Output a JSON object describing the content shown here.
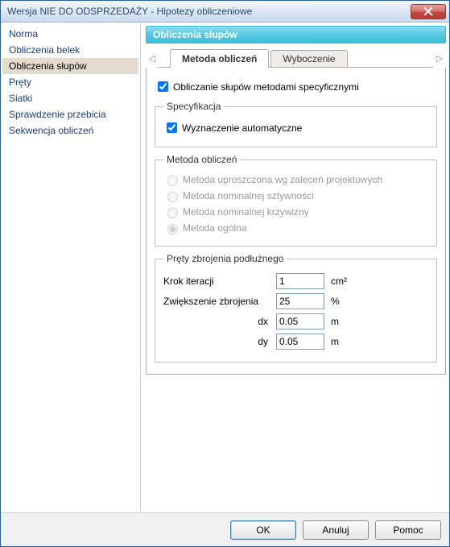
{
  "titlebar": {
    "text": "Wersja NIE DO ODSPRZEDAŻY - Hipotezy obliczeniowe"
  },
  "sidebar": {
    "items": [
      {
        "label": "Norma",
        "selected": false
      },
      {
        "label": "Obliczenia belek",
        "selected": false
      },
      {
        "label": "Obliczenia słupów",
        "selected": true
      },
      {
        "label": "Pręty",
        "selected": false
      },
      {
        "label": "Siatki",
        "selected": false
      },
      {
        "label": "Sprawdzenie przebicia",
        "selected": false
      },
      {
        "label": "Sekwencja obliczeń",
        "selected": false
      }
    ]
  },
  "content": {
    "section_title": "Obliczenia słupów",
    "tabs": [
      {
        "label": "Metoda obliczeń",
        "active": true
      },
      {
        "label": "Wyboczenie",
        "active": false
      }
    ],
    "main_check": {
      "label": "Obliczanie słupów metodami specyficznymi",
      "checked": true
    },
    "spec_group": {
      "legend": "Specyfikacja",
      "check": {
        "label": "Wyznaczenie automatyczne",
        "checked": true
      }
    },
    "method_group": {
      "legend": "Metoda obliczeń",
      "options": [
        {
          "label": "Metoda uproszczona wg zaleceń projektowych",
          "disabled": true,
          "checked": false
        },
        {
          "label": "Metoda nominalnej sztywności",
          "disabled": true,
          "checked": false
        },
        {
          "label": "Metoda nominalnej krzywizny",
          "disabled": true,
          "checked": false
        },
        {
          "label": "Metoda ogólna",
          "disabled": true,
          "checked": true
        }
      ]
    },
    "rebar_group": {
      "legend": "Pręty zbrojenia podłużnego",
      "params": [
        {
          "label": "Krok iteracji",
          "value": "1",
          "unit": "cm²",
          "align": "left"
        },
        {
          "label": "Zwiększenie zbrojenia",
          "value": "25",
          "unit": "%",
          "align": "left"
        },
        {
          "label": "dx",
          "value": "0.05",
          "unit": "m",
          "align": "right"
        },
        {
          "label": "dy",
          "value": "0.05",
          "unit": "m",
          "align": "right"
        }
      ]
    }
  },
  "footer": {
    "ok": "OK",
    "cancel": "Anuluj",
    "help": "Pomoc"
  }
}
